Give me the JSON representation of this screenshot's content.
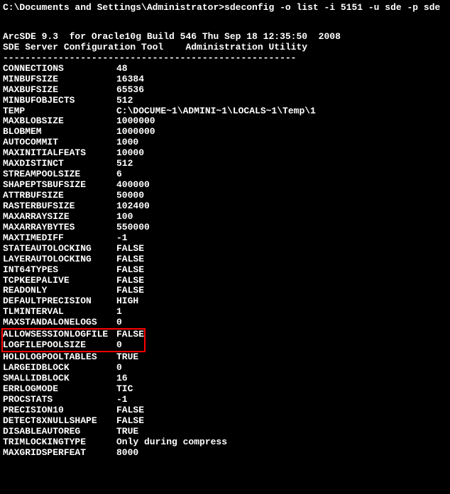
{
  "command_line": "C:\\Documents and Settings\\Administrator>sdeconfig -o list -i 5151 -u sde -p sde",
  "header1": "ArcSDE 9.3  for Oracle10g Build 546 Thu Sep 18 12:35:50  2008",
  "header2": "SDE Server Configuration Tool    Administration Utility",
  "separator": "-----------------------------------------------------",
  "config": [
    {
      "name": "CONNECTIONS",
      "value": "48"
    },
    {
      "name": "MINBUFSIZE",
      "value": "16384"
    },
    {
      "name": "MAXBUFSIZE",
      "value": "65536"
    },
    {
      "name": "MINBUFOBJECTS",
      "value": "512"
    },
    {
      "name": "TEMP",
      "value": "C:\\DOCUME~1\\ADMINI~1\\LOCALS~1\\Temp\\1"
    },
    {
      "name": "MAXBLOBSIZE",
      "value": "1000000"
    },
    {
      "name": "BLOBMEM",
      "value": "1000000"
    },
    {
      "name": "AUTOCOMMIT",
      "value": "1000"
    },
    {
      "name": "MAXINITIALFEATS",
      "value": "10000"
    },
    {
      "name": "MAXDISTINCT",
      "value": "512"
    },
    {
      "name": "STREAMPOOLSIZE",
      "value": "6"
    },
    {
      "name": "SHAPEPTSBUFSIZE",
      "value": "400000"
    },
    {
      "name": "ATTRBUFSIZE",
      "value": "50000"
    },
    {
      "name": "RASTERBUFSIZE",
      "value": "102400"
    },
    {
      "name": "MAXARRAYSIZE",
      "value": "100"
    },
    {
      "name": "MAXARRAYBYTES",
      "value": "550000"
    },
    {
      "name": "MAXTIMEDIFF",
      "value": "-1"
    },
    {
      "name": "STATEAUTOLOCKING",
      "value": "FALSE"
    },
    {
      "name": "LAYERAUTOLOCKING",
      "value": "FALSE"
    },
    {
      "name": "INT64TYPES",
      "value": "FALSE"
    },
    {
      "name": "TCPKEEPALIVE",
      "value": "FALSE"
    },
    {
      "name": "READONLY",
      "value": "FALSE"
    },
    {
      "name": "DEFAULTPRECISION",
      "value": "HIGH"
    },
    {
      "name": "TLMINTERVAL",
      "value": "1"
    },
    {
      "name": "MAXSTANDALONELOGS",
      "value": "0"
    }
  ],
  "highlighted": [
    {
      "name": "ALLOWSESSIONLOGFILE",
      "value": "FALSE"
    },
    {
      "name": "LOGFILEPOOLSIZE",
      "value": "0"
    }
  ],
  "config2": [
    {
      "name": "HOLDLOGPOOLTABLES",
      "value": "TRUE"
    },
    {
      "name": "LARGEIDBLOCK",
      "value": "0"
    },
    {
      "name": "SMALLIDBLOCK",
      "value": "16"
    },
    {
      "name": "ERRLOGMODE",
      "value": "TIC"
    },
    {
      "name": "PROCSTATS",
      "value": "-1"
    },
    {
      "name": "PRECISION10",
      "value": "FALSE"
    },
    {
      "name": "DETECT8XNULLSHAPE",
      "value": "FALSE"
    },
    {
      "name": "DISABLEAUTOREG",
      "value": "TRUE"
    },
    {
      "name": "TRIMLOCKINGTYPE",
      "value": "Only during compress"
    },
    {
      "name": "MAXGRIDSPERFEAT",
      "value": "8000"
    }
  ]
}
